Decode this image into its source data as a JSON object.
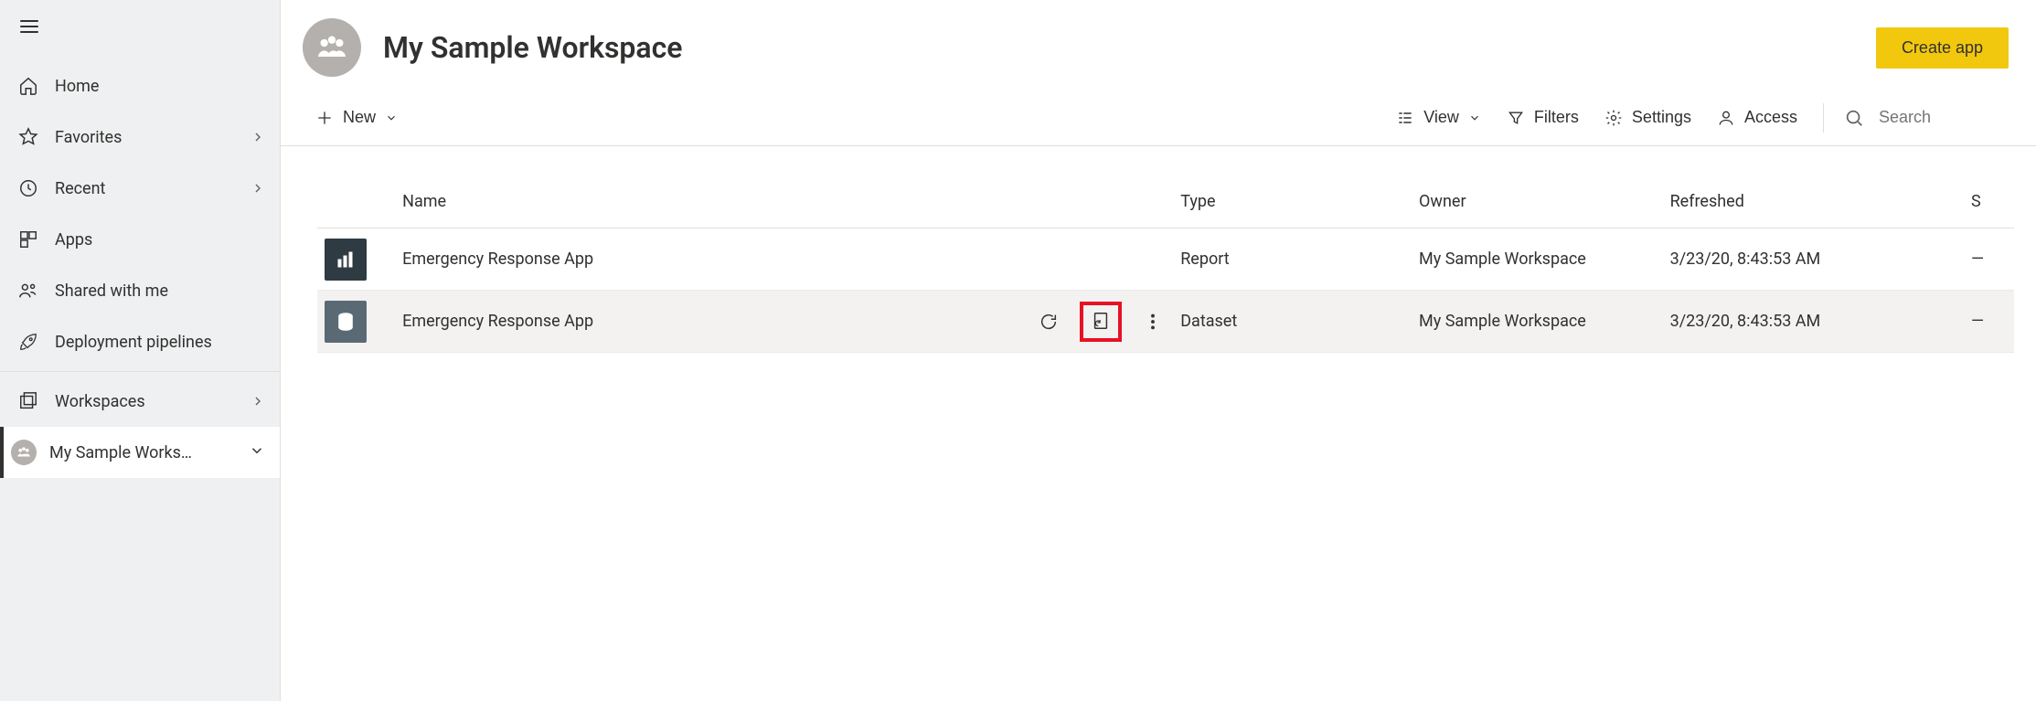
{
  "sidebar": {
    "items": [
      {
        "icon": "home",
        "label": "Home",
        "hasChevron": false
      },
      {
        "icon": "star",
        "label": "Favorites",
        "hasChevron": true
      },
      {
        "icon": "clock",
        "label": "Recent",
        "hasChevron": true
      },
      {
        "icon": "apps",
        "label": "Apps",
        "hasChevron": false
      },
      {
        "icon": "shared",
        "label": "Shared with me",
        "hasChevron": false
      },
      {
        "icon": "rocket",
        "label": "Deployment pipelines",
        "hasChevron": false
      }
    ],
    "workspaces_label": "Workspaces",
    "current_workspace": "My Sample Works…"
  },
  "header": {
    "title": "My Sample Workspace",
    "create_app_label": "Create app"
  },
  "toolbar": {
    "new_label": "New",
    "view_label": "View",
    "filters_label": "Filters",
    "settings_label": "Settings",
    "access_label": "Access",
    "search_placeholder": "Search"
  },
  "table": {
    "columns": {
      "name": "Name",
      "type": "Type",
      "owner": "Owner",
      "refreshed": "Refreshed",
      "last": "S"
    },
    "rows": [
      {
        "kind": "report",
        "name": "Emergency Response App",
        "type": "Report",
        "owner": "My Sample Workspace",
        "refreshed": "3/23/20, 8:43:53 AM",
        "last": "—",
        "showActions": false
      },
      {
        "kind": "dataset",
        "name": "Emergency Response App",
        "type": "Dataset",
        "owner": "My Sample Workspace",
        "refreshed": "3/23/20, 8:43:53 AM",
        "last": "—",
        "showActions": true
      }
    ]
  }
}
